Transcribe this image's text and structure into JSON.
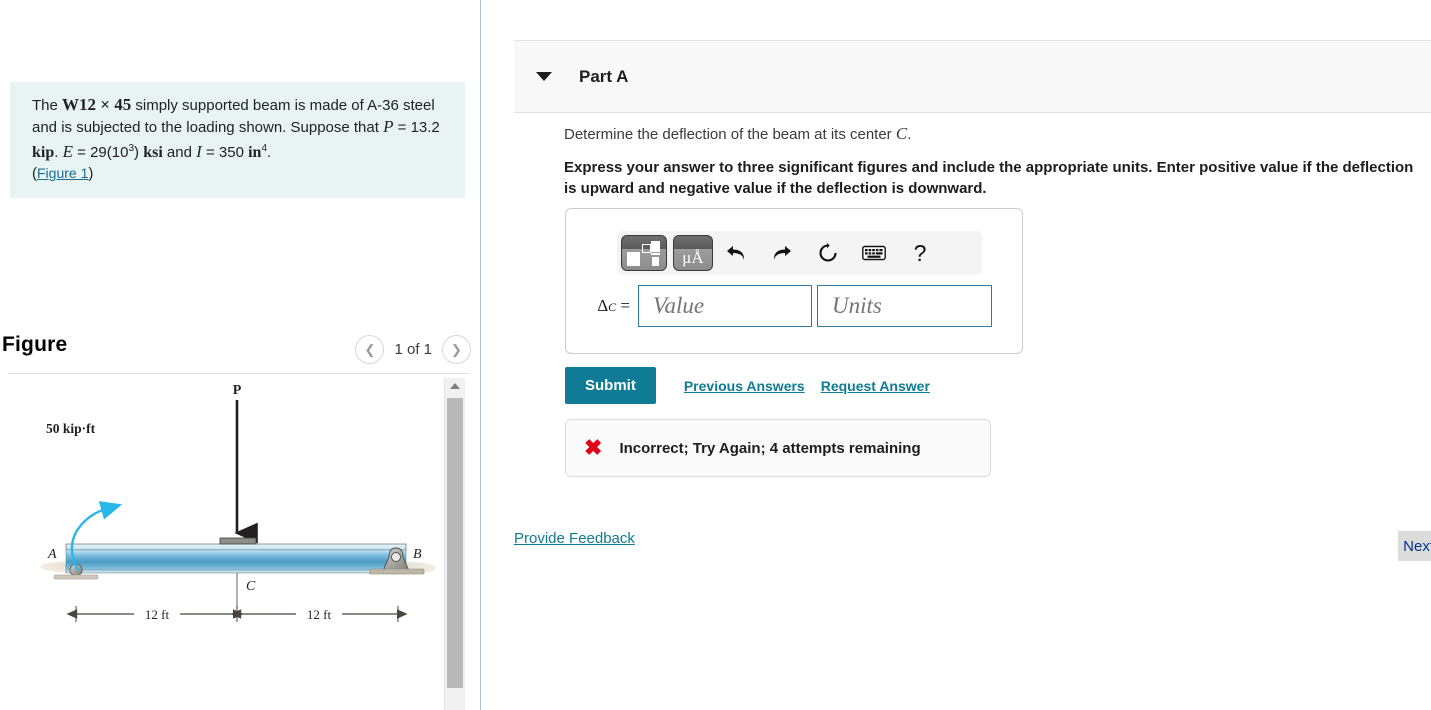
{
  "problem": {
    "text_part1": "The ",
    "beam_spec": "W12 × 45",
    "text_part2": " simply supported beam is made of A-36 steel and is subjected to the loading shown. Suppose that ",
    "var_P": "P",
    "p_value": " = 13.2 ",
    "p_unit": "kip",
    "sep1": ". ",
    "var_E": "E",
    "e_value": " = 29(10",
    "e_exp": "3",
    "e_value_end": ") ",
    "e_unit": "ksi",
    "and_text": " and ",
    "var_I": "I",
    "i_value": " = 350 ",
    "i_unit": "in",
    "i_exp": "4",
    "period": ".",
    "figure_link": "Figure 1",
    "paren_open": "(",
    "paren_close": ")"
  },
  "figure": {
    "title": "Figure",
    "counter": "1 of 1",
    "prev_icon": "chevron-left-icon",
    "next_icon": "chevron-right-icon",
    "diagram": {
      "moment_label": "50 kip·ft",
      "support_a_label": "A",
      "support_b_label": "B",
      "load_label": "P",
      "center_label": "C",
      "dim_left": "12 ft",
      "dim_right": "12 ft",
      "beam_color": "#5ba7cf",
      "moment_arrow_color": "#29b6e8"
    }
  },
  "part": {
    "title": "Part A",
    "caret_icon": "caret-down-icon",
    "question": "Determine the deflection of the beam at its center ",
    "question_var": "C",
    "question_end": ".",
    "instruction": "Express your answer to three significant figures and include the appropriate units. Enter positive value if the deflection is upward and negative value if the deflection is downward."
  },
  "toolbar": {
    "template_icon": "math-template-icon",
    "units_label": "μÅ",
    "units_icon": "units-icon",
    "undo_icon": "undo-arrow-icon",
    "redo_icon": "redo-arrow-icon",
    "reset_icon": "reset-circle-icon",
    "keyboard_icon": "keyboard-icon",
    "help_icon": "question-mark-icon",
    "help_label": "?",
    "undo_glyph": "⬅",
    "redo_glyph": "➡",
    "reset_glyph": "↻"
  },
  "answer": {
    "delta_symbol": "Δ",
    "delta_sub": "C",
    "equals": " =",
    "value_placeholder": "Value",
    "units_placeholder": "Units",
    "value_current": "",
    "units_current": ""
  },
  "actions": {
    "submit_label": "Submit",
    "previous_answers_label": "Previous Answers",
    "request_answer_label": "Request Answer",
    "provide_feedback_label": "Provide Feedback",
    "next_label": "Next"
  },
  "feedback": {
    "icon": "x-mark-icon",
    "glyph": "✖",
    "message": "Incorrect; Try Again; 4 attempts remaining",
    "color": "#e00019"
  },
  "colors": {
    "accent": "#0f7b94",
    "problem_bg": "#e7f4f3",
    "divider": "#adc3d1",
    "input_border": "#2e7d9a"
  }
}
